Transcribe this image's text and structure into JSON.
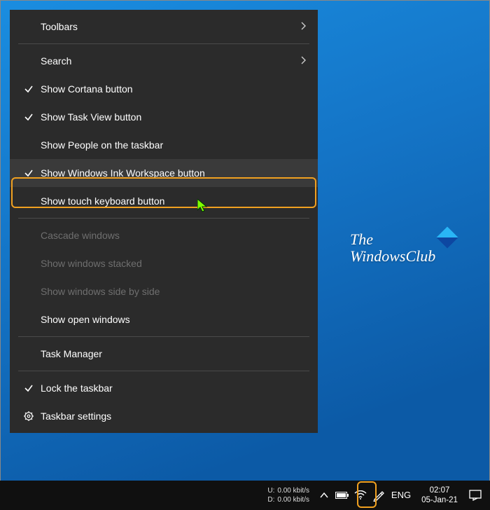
{
  "menu": {
    "toolbars": "Toolbars",
    "search": "Search",
    "show_cortana": "Show Cortana button",
    "show_taskview": "Show Task View button",
    "show_people": "Show People on the taskbar",
    "show_ink": "Show Windows Ink Workspace button",
    "show_touch_kb": "Show touch keyboard button",
    "cascade": "Cascade windows",
    "stacked": "Show windows stacked",
    "sidebyside": "Show windows side by side",
    "open_windows": "Show open windows",
    "task_manager": "Task Manager",
    "lock_taskbar": "Lock the taskbar",
    "taskbar_settings": "Taskbar settings"
  },
  "watermark": {
    "line1": "The",
    "line2": "WindowsClub"
  },
  "taskbar": {
    "net_up_label": "U:",
    "net_up_value": "0.00 kbit/s",
    "net_down_label": "D:",
    "net_down_value": "0.00 kbit/s",
    "lang": "ENG",
    "time": "02:07",
    "date": "05-Jan-21"
  }
}
